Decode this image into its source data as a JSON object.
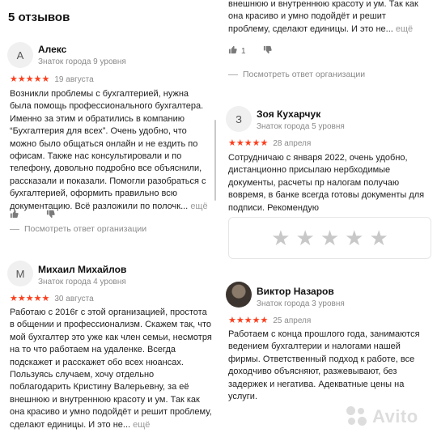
{
  "heading": "5 отзывов",
  "left": {
    "review1": {
      "avatar_letter": "А",
      "name": "Алекс",
      "level": "Знаток города 9 уровня",
      "rating": 5,
      "date": "19 августа",
      "text": "Возникли проблемы с бухгалтерией, нужна была помощь профессионального бухгалтера. Именно за этим и обратились в компанию “Бухгалтерия для всех”. Очень удобно, что можно было общаться онлайн и не ездить по офисам. Также нас консультировали и по телефону, довольно подробно все объяснили, рассказали и показали. Помогли разобраться с бухгалтерией, оформить правильно всю документацию. Всё разложили по полочк...",
      "more": "ещё",
      "likes": "",
      "owner_reply": "Посмотреть ответ организации"
    },
    "review2": {
      "avatar_letter": "М",
      "name": "Михаил Михайлов",
      "level": "Знаток города 4 уровня",
      "rating": 5,
      "date": "30 августа",
      "text": "Работаю с 2016г с этой организацией, простота в общении и профессионализм. Скажем так, что мой бухгалтер это уже как член семьи, несмотря на то что работаем на удаленке. Всегда подскажет и расскажет обо всех нюансах. Пользуясь случаем, хочу отдельно поблагодарить Кристину Валерьевну, за её внешнюю и внутреннюю красоту и ум. Так как она красиво и умно подойдёт и решит проблему, сделают единицы. И это не...",
      "more": "ещё"
    }
  },
  "right": {
    "review_tail": {
      "text": "внешнюю и внутреннюю красоту и ум. Так как она красиво и умно подойдёт и решит проблему, сделают единицы. И это не...",
      "more": "ещё",
      "likes": "1",
      "owner_reply": "Посмотреть ответ организации"
    },
    "review3": {
      "avatar_letter": "З",
      "name": "Зоя Кухарчук",
      "level": "Знаток города 5 уровня",
      "rating": 5,
      "date": "28 апреля",
      "text": "Сотрудничаю с января 2022, очень удобно, дистанционно присылаю нербходимые документы, расчеты пр налогам получаю вовремя, в банке всегда готовы документы для подписи. Рекомендую"
    },
    "rate_widget": {
      "stars": 5
    },
    "review4": {
      "name": "Виктор Назаров",
      "level": "Знаток города 3 уровня",
      "rating": 5,
      "date": "25 апреля",
      "text": "Работаем с конца прошлого года, занимаются ведением бухгалтерии и налогами нашей фирмы. Ответственный подход к работе, все доходчиво объясняют, разжевывают, без задержек и негатива. Адекватные цены на услуги."
    }
  },
  "watermark": "Avito",
  "colors": {
    "star": "#fc3f1d",
    "muted": "#8a8a8a",
    "more": "#9a9a9a"
  },
  "icons": [
    "thumbs-up-icon",
    "thumbs-down-icon",
    "star-icon",
    "avito-logo-icon"
  ]
}
